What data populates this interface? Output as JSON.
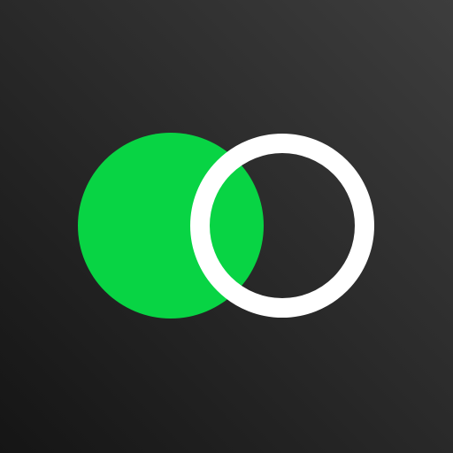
{
  "logo": {
    "icon_name": "overlapping-circles-logo",
    "colors": {
      "background_light": "#3d3d3d",
      "background_dark": "#151515",
      "accent_green": "#08d444",
      "ring_white": "#ffffff"
    }
  }
}
